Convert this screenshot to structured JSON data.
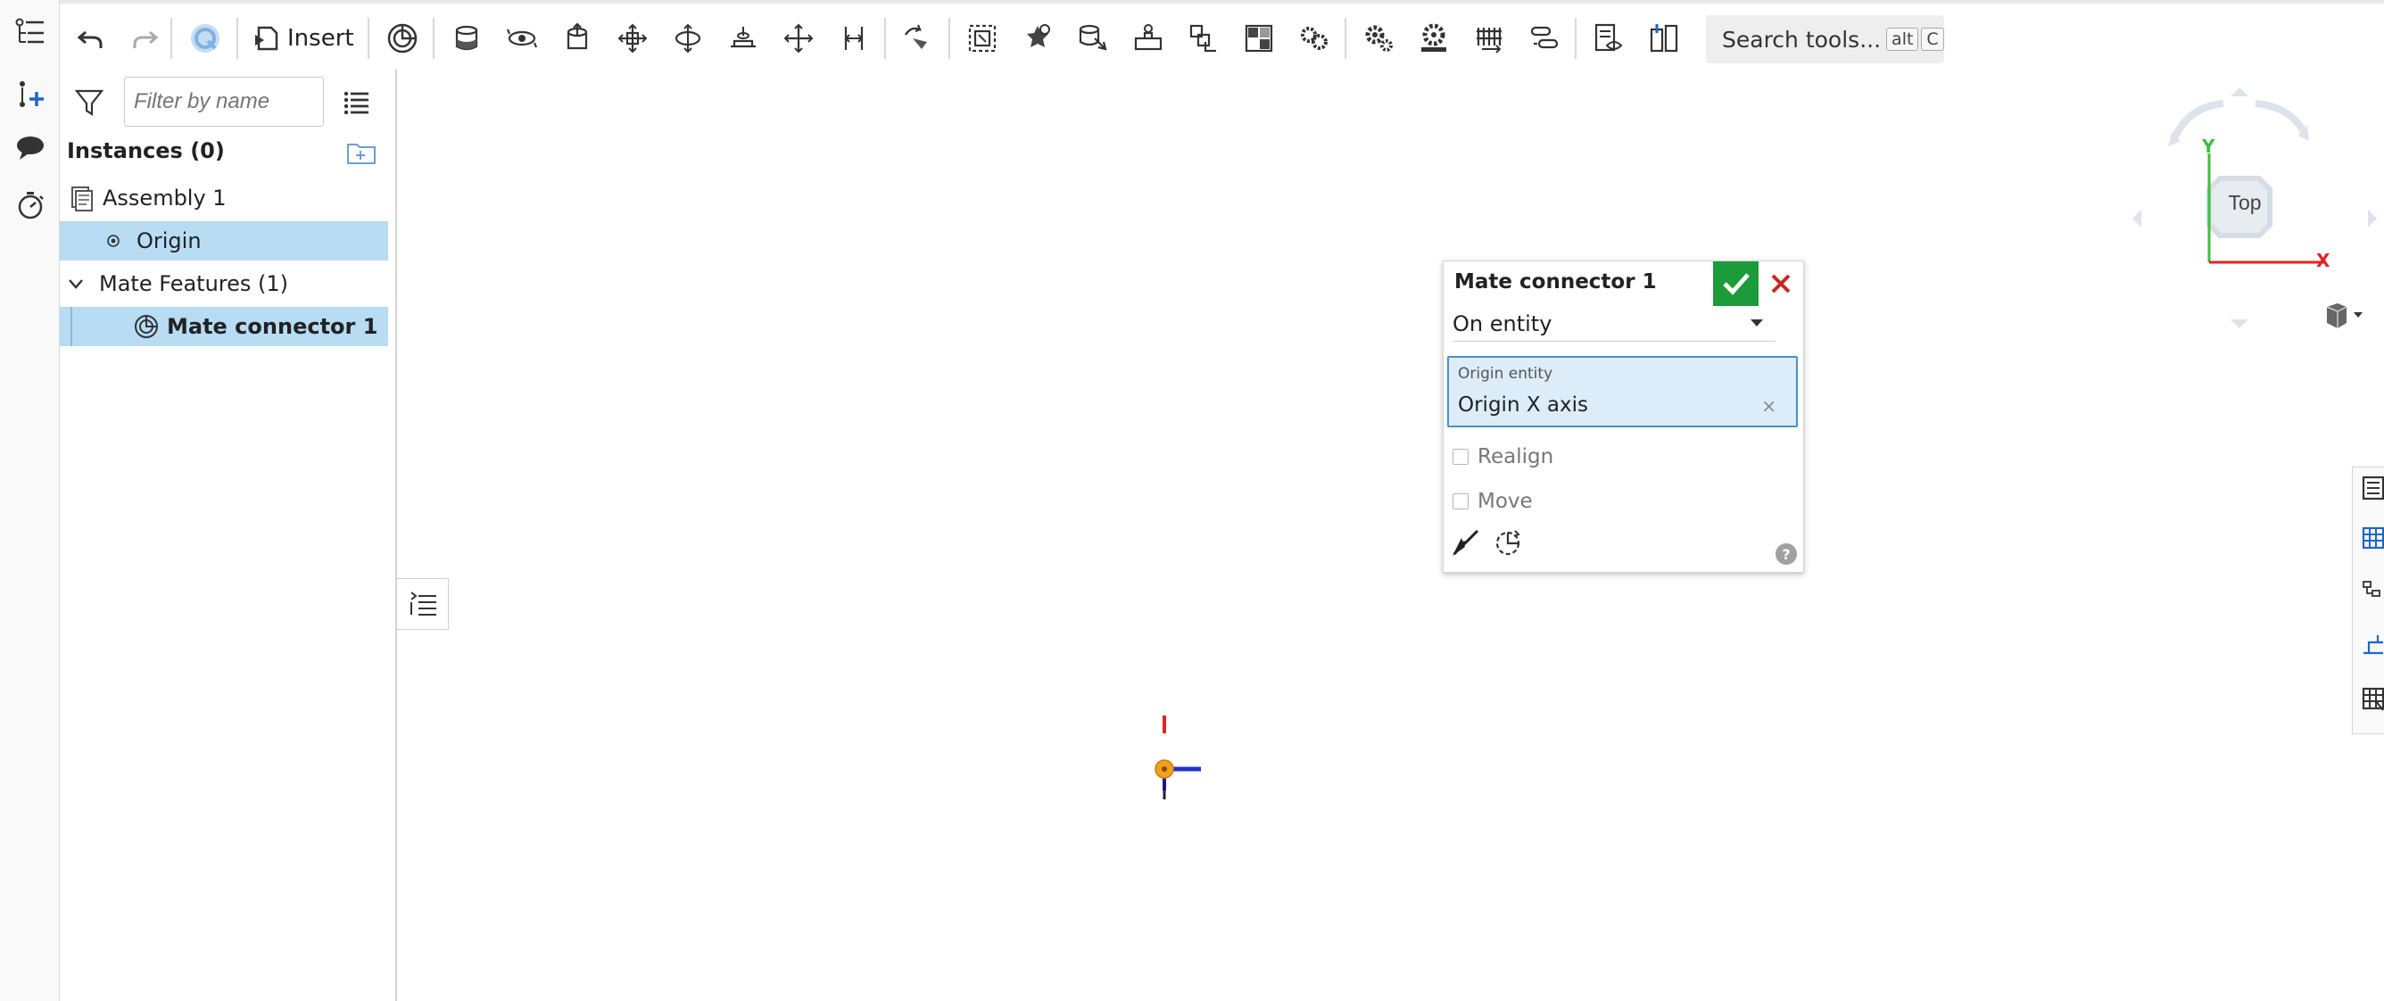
{
  "toolbar": {
    "insert_label": "Insert",
    "search_label": "Search tools...",
    "search_kbd_1": "alt",
    "search_kbd_2": "C"
  },
  "feature_panel": {
    "filter_placeholder": "Filter by name",
    "instances_title": "Instances (0)",
    "tree": {
      "assembly": "Assembly 1",
      "origin": "Origin",
      "mate_features": "Mate Features (1)",
      "mate_connector": "Mate connector 1"
    }
  },
  "dialog": {
    "title": "Mate connector 1",
    "dropdown_value": "On entity",
    "origin_entity_label": "Origin entity",
    "origin_entity_value": "Origin X axis",
    "clear_glyph": "×",
    "realign_label": "Realign",
    "move_label": "Move",
    "help_glyph": "?"
  },
  "view_cube": {
    "face_label": "Top",
    "axis_y": "Y",
    "axis_x": "X"
  },
  "colors": {
    "selection": "#b7dcf4",
    "ok_green": "#1c9b3a",
    "cancel_red": "#c62828",
    "field_bg": "#dcecf8",
    "origin_orange": "#f2a01e"
  }
}
